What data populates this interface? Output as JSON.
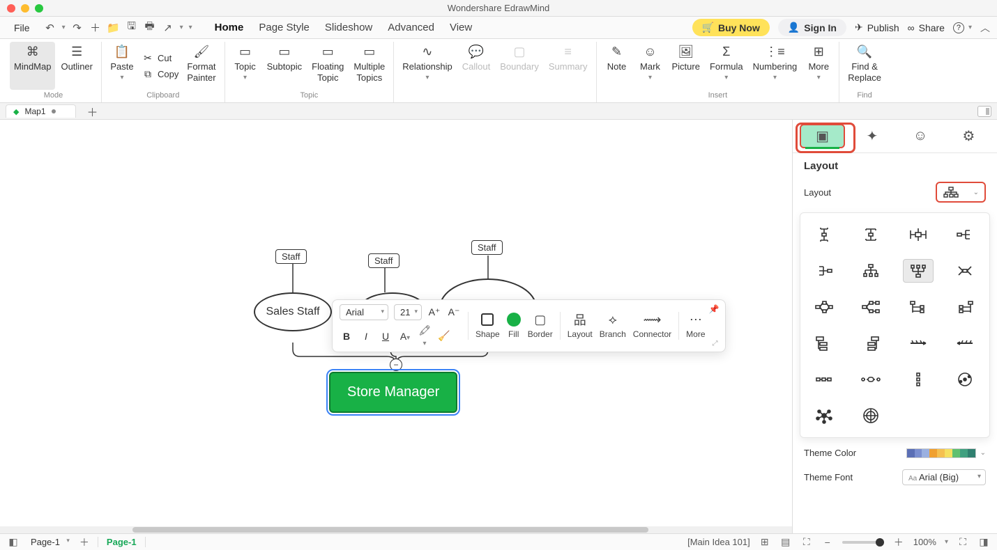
{
  "app": {
    "title": "Wondershare EdrawMind"
  },
  "menu": {
    "file": "File",
    "tabs": [
      "Home",
      "Page Style",
      "Slideshow",
      "Advanced",
      "View"
    ],
    "buy": "Buy Now",
    "signin": "Sign In",
    "publish": "Publish",
    "share": "Share"
  },
  "ribbon": {
    "mindmap": "MindMap",
    "outliner": "Outliner",
    "mode": "Mode",
    "paste": "Paste",
    "cut": "Cut",
    "copy": "Copy",
    "format_painter": "Format\nPainter",
    "clipboard": "Clipboard",
    "topic": "Topic",
    "subtopic": "Subtopic",
    "floating": "Floating\nTopic",
    "multiple": "Multiple\nTopics",
    "topic_group": "Topic",
    "relationship": "Relationship",
    "callout": "Callout",
    "boundary": "Boundary",
    "summary": "Summary",
    "note": "Note",
    "mark": "Mark",
    "picture": "Picture",
    "formula": "Formula",
    "numbering": "Numbering",
    "more": "More",
    "insert": "Insert",
    "find_replace": "Find &\nReplace",
    "find": "Find"
  },
  "doc": {
    "tab1": "Map1"
  },
  "canvas": {
    "staff1": "Staff",
    "staff2": "Staff",
    "staff3": "Staff",
    "sales_staff": "Sales Staff",
    "store_manager": "Store Manager",
    "collapse": "−"
  },
  "float": {
    "font": "Arial",
    "size": "21",
    "shape": "Shape",
    "fill": "Fill",
    "border": "Border",
    "layout": "Layout",
    "branch": "Branch",
    "connector": "Connector",
    "more": "More"
  },
  "panel": {
    "layout_h": "Layout",
    "layout_l": "Layout",
    "theme_color": "Theme Color",
    "theme_font": "Theme Font",
    "font_val": "Arial (Big)"
  },
  "status": {
    "page_dd": "Page-1",
    "page_tab": "Page-1",
    "main_idea": "[Main Idea 101]",
    "zoom": "100%"
  },
  "colors": [
    "#5b6fb5",
    "#7b8fd0",
    "#9bb0e0",
    "#f0a030",
    "#f5c050",
    "#f5e060",
    "#60c070",
    "#40a080",
    "#308070"
  ]
}
